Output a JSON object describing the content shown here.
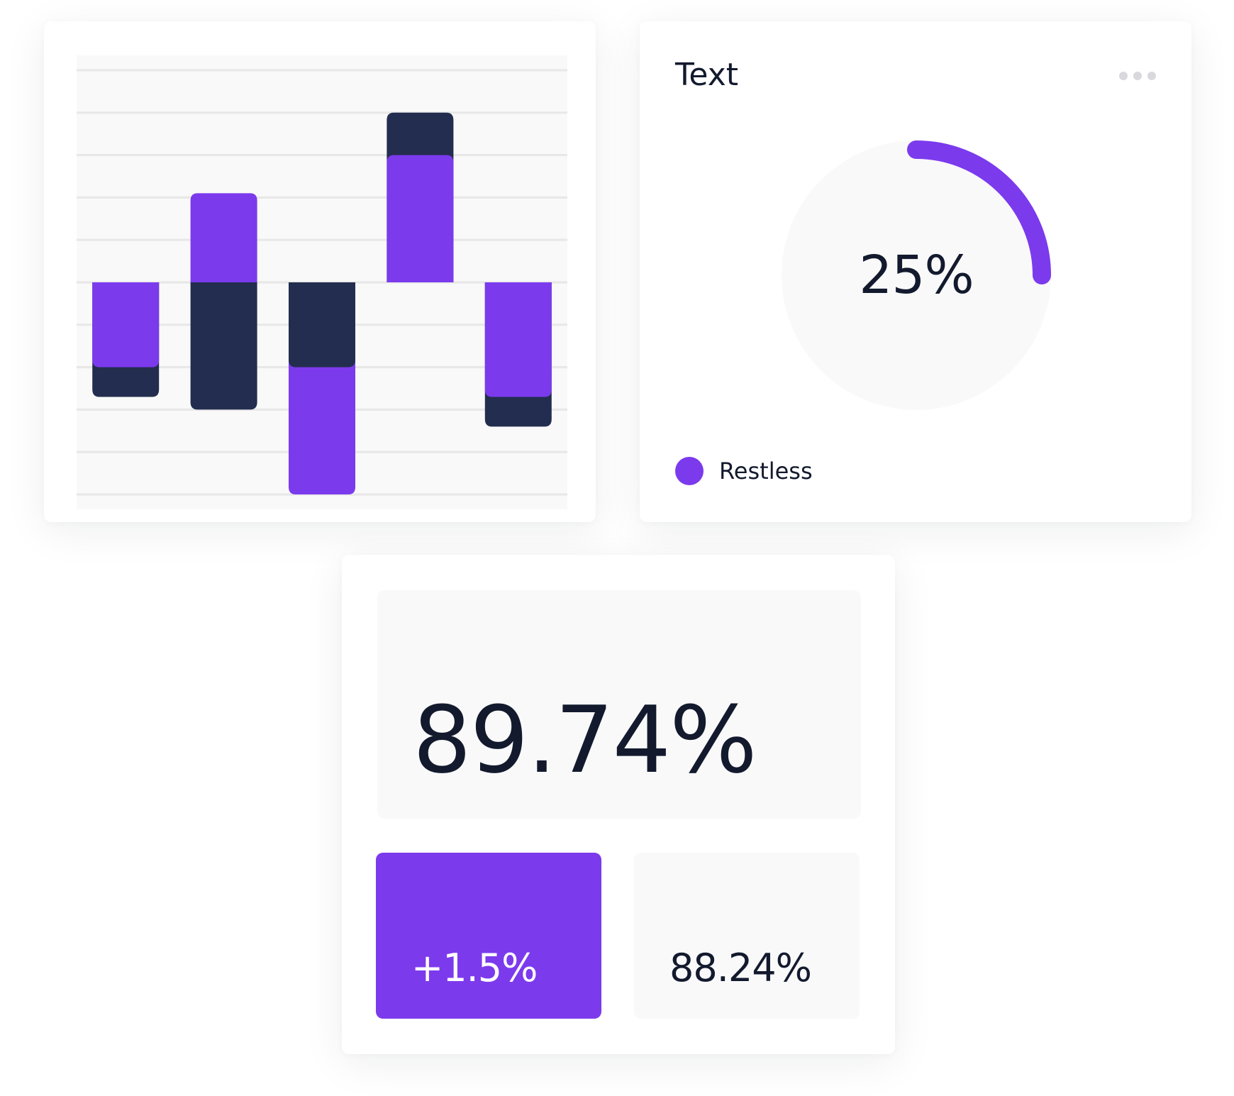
{
  "colors": {
    "accent": "#7c3aed",
    "dark": "#232d4f",
    "grid": "#e8e8e8",
    "panel": "#f9f9f9",
    "text": "#131a2e"
  },
  "chart_data": {
    "type": "bar",
    "categories": [
      "",
      "",
      "",
      "",
      ""
    ],
    "ylim": [
      -5,
      5
    ],
    "baseline": 0,
    "grid": true,
    "series": [
      {
        "values": [
          -2.7,
          -3.0,
          -2.0,
          4.0,
          -3.4
        ]
      },
      {
        "values": [
          -2.0,
          2.1,
          -5.0,
          3.0,
          -2.7
        ]
      }
    ]
  },
  "donut": {
    "title": "Text",
    "percent": 25,
    "value_label": "25%",
    "legend_label": "Restless",
    "more_icon": "more-horizontal-icon"
  },
  "stats": {
    "main_value": "89.74%",
    "change_value": "+1.5%",
    "secondary_value": "88.24%"
  }
}
